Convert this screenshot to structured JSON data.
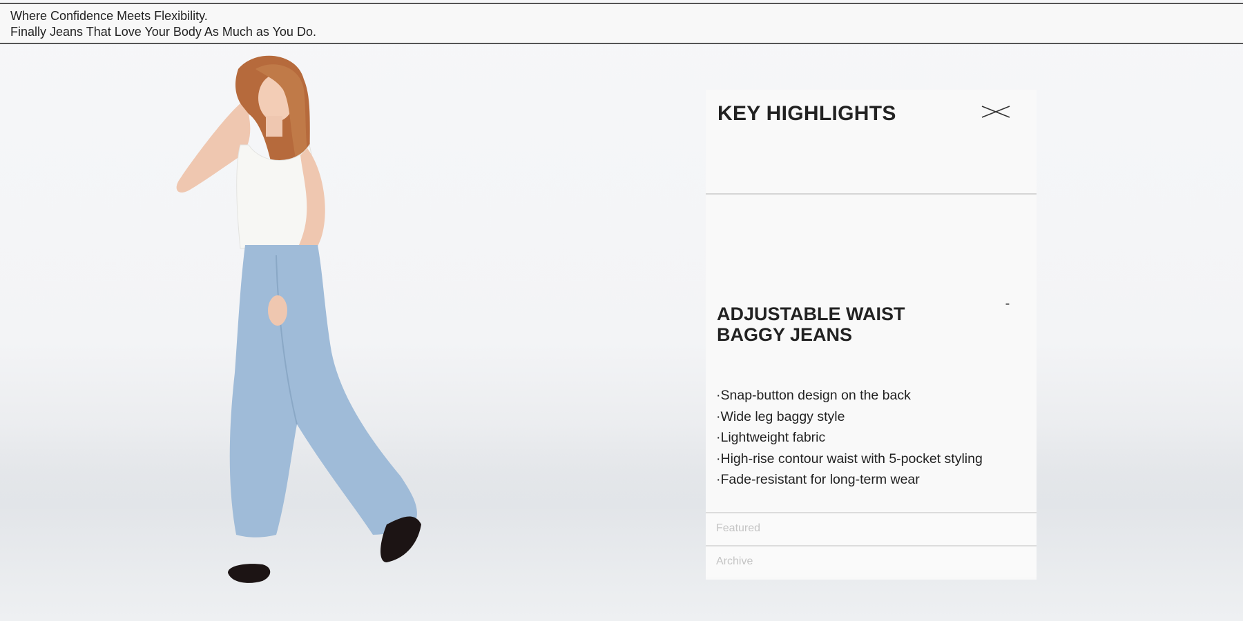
{
  "banner": {
    "line1": "Where Confidence Meets Flexibility.",
    "line2": "Finally Jeans That Love Your Body As Much as You Do."
  },
  "hero_image": {
    "description_icon": "model-photo-icon"
  },
  "panel": {
    "title": "KEY HIGHLIGHTS",
    "close_icon": "close-icon",
    "product_name": "ADJUSTABLE WAIST BAGGY JEANS",
    "collapse_symbol": "-",
    "features": [
      "·Snap-button design on the back",
      "·Wide leg baggy style",
      "·Lightweight fabric",
      "·High-rise contour waist with 5-pocket styling",
      "·Fade-resistant for long-term wear"
    ],
    "nav": {
      "featured": "Featured",
      "archive": "Archive"
    }
  },
  "colors": {
    "panel_bg": "#f9f9f9",
    "denim": "#9fbbd8",
    "text": "#222222",
    "muted_nav": "#c4c4c4"
  }
}
